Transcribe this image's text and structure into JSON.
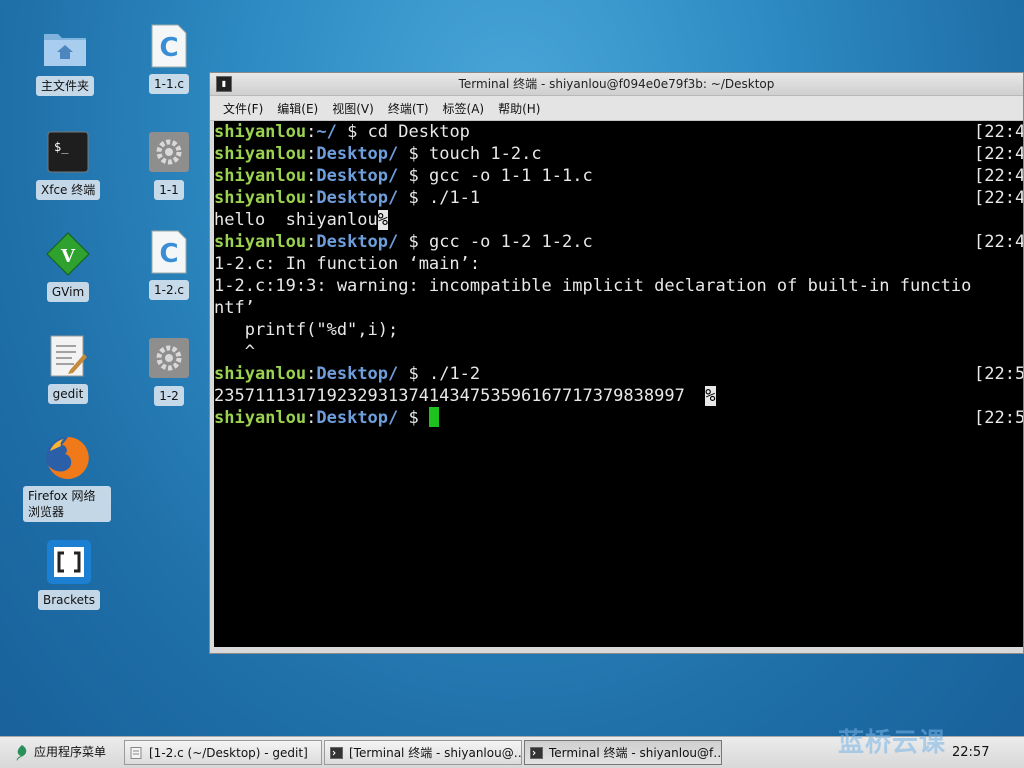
{
  "desktop": {
    "icons": [
      {
        "label": "主文件夹",
        "icon": "home-folder-icon"
      },
      {
        "label": "1-1.c",
        "icon": "c-source-file-icon"
      },
      {
        "label": "Xfce 终端",
        "icon": "terminal-icon"
      },
      {
        "label": "1-1",
        "icon": "executable-gear-icon"
      },
      {
        "label": "GVim",
        "icon": "gvim-icon"
      },
      {
        "label": "1-2.c",
        "icon": "c-source-file-icon"
      },
      {
        "label": "gedit",
        "icon": "gedit-icon"
      },
      {
        "label": "1-2",
        "icon": "executable-gear-icon"
      },
      {
        "label": "Firefox 网络浏览器",
        "icon": "firefox-icon"
      },
      {
        "label": "Brackets",
        "icon": "brackets-icon"
      }
    ]
  },
  "window": {
    "title": "Terminal 终端 - shiyanlou@f094e0e79f3b: ~/Desktop",
    "menu": [
      "文件(F)",
      "编辑(E)",
      "视图(V)",
      "终端(T)",
      "标签(A)",
      "帮助(H)"
    ]
  },
  "terminal": {
    "user": "shiyanlou",
    "lines": [
      {
        "path": "~/",
        "cmd": "$ cd Desktop",
        "ts": "[22:4"
      },
      {
        "path": "Desktop/",
        "cmd": "$ touch 1-2.c",
        "ts": "[22:4"
      },
      {
        "path": "Desktop/",
        "cmd": "$ gcc -o 1-1 1-1.c",
        "ts": "[22:4"
      },
      {
        "path": "Desktop/",
        "cmd": "$ ./1-1",
        "ts": "[22:4"
      },
      {
        "output": "hello  shiyanlou",
        "mark": "%"
      },
      {
        "path": "Desktop/",
        "cmd": "$ gcc -o 1-2 1-2.c",
        "ts": "[22:4"
      },
      {
        "output": "1-2.c: In function ‘main’:"
      },
      {
        "output": "1-2.c:19:3: warning: incompatible implicit declaration of built-in functio"
      },
      {
        "output": "ntf’"
      },
      {
        "output": "   printf(\"%d\",i);"
      },
      {
        "output": "   ^"
      },
      {
        "path": "Desktop/",
        "cmd": "$ ./1-2",
        "ts": "[22:5"
      },
      {
        "output": "2357111317192329313741434753596167717379838997  ",
        "mark": "%"
      },
      {
        "path": "Desktop/",
        "cmd": "$ ",
        "ts": "[22:5",
        "cursor": true
      }
    ]
  },
  "taskbar": {
    "app_menu": "应用程序菜单",
    "buttons": [
      {
        "label": "[1-2.c (~/Desktop) - gedit]",
        "icon": "gedit-icon"
      },
      {
        "label": "[Terminal 终端 - shiyanlou@…",
        "icon": "terminal-icon"
      },
      {
        "label": "Terminal 终端 - shiyanlou@f…",
        "icon": "terminal-icon",
        "active": true
      }
    ],
    "clock": "22:57"
  },
  "watermark": "蓝桥云课",
  "colors": {
    "user": "#9bd24f",
    "path": "#6e9fdc",
    "cursor": "#1ec21e"
  }
}
